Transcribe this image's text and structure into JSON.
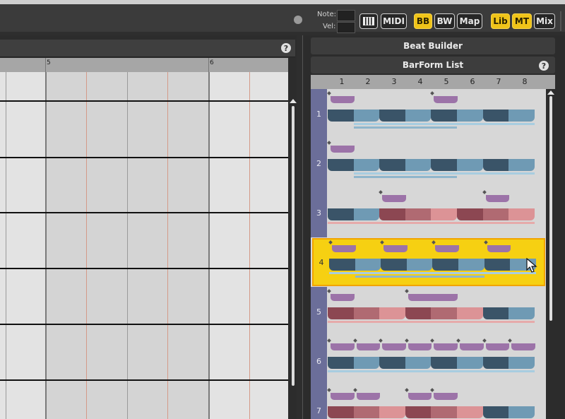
{
  "topbar": {
    "note_label": "Note:",
    "vel_label": "Vel:",
    "piano_icon": "piano-icon",
    "buttons": [
      {
        "label": "MIDI",
        "active": false
      },
      {
        "label": "BB",
        "active": true
      },
      {
        "label": "BW",
        "active": false
      },
      {
        "label": "Map",
        "active": false
      },
      {
        "label": "Lib",
        "active": true
      },
      {
        "label": "MT",
        "active": true
      },
      {
        "label": "Mix",
        "active": false
      }
    ]
  },
  "editor": {
    "help": "?",
    "ruler": [
      "5",
      "6"
    ]
  },
  "beat_builder": {
    "title": "Beat Builder",
    "barform_title": "BarForm List",
    "help": "?",
    "columns": [
      "1",
      "2",
      "3",
      "4",
      "5",
      "6",
      "7",
      "8"
    ],
    "rows": [
      {
        "number": "1"
      },
      {
        "number": "2"
      },
      {
        "number": "3"
      },
      {
        "number": "4",
        "selected": true
      },
      {
        "number": "5"
      },
      {
        "number": "6"
      },
      {
        "number": "7"
      }
    ]
  },
  "colors": {
    "accent": "#f0c419",
    "segment_dark": "#3a5468",
    "segment_blue": "#6f9ab4",
    "segment_red": "#8c4752",
    "segment_rose": "#b06a72",
    "segment_pink": "#dc9396",
    "sub_purple": "#9c73a8",
    "bar_blue": "#a8cde0",
    "bar_pink": "#e6aaaa"
  }
}
